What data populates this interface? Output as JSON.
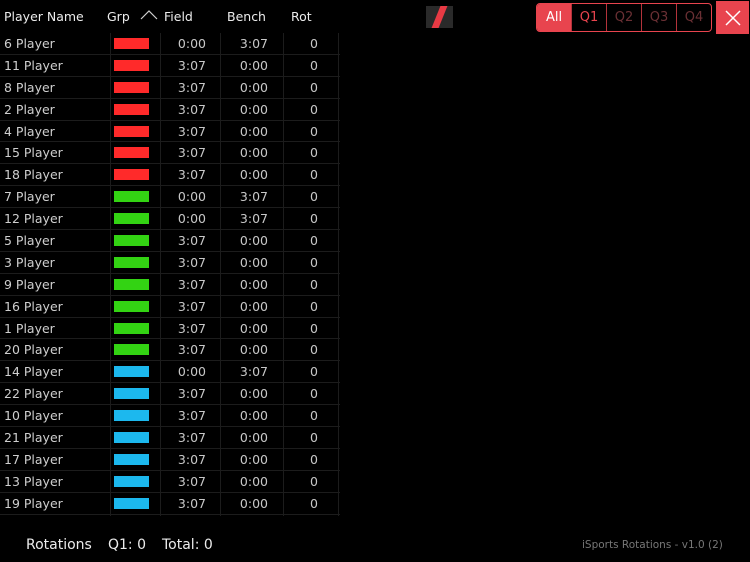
{
  "header": {
    "player_name": "Player Name",
    "grp": "Grp",
    "field": "Field",
    "bench": "Bench",
    "rot": "Rot",
    "sort_icon": "chevron-up-icon"
  },
  "filter": {
    "options": [
      "All",
      "Q1",
      "Q2",
      "Q3",
      "Q4"
    ],
    "selected": "All",
    "accent": "#e8444e"
  },
  "close_icon": "close-icon",
  "group_colors": {
    "red": "#ff2a2a",
    "green": "#33d313",
    "blue": "#1cb8ee"
  },
  "players": [
    {
      "name": "6 Player",
      "group": "red",
      "field": "0:00",
      "bench": "3:07",
      "rot": "0"
    },
    {
      "name": "11 Player",
      "group": "red",
      "field": "3:07",
      "bench": "0:00",
      "rot": "0"
    },
    {
      "name": "8 Player",
      "group": "red",
      "field": "3:07",
      "bench": "0:00",
      "rot": "0"
    },
    {
      "name": "2 Player",
      "group": "red",
      "field": "3:07",
      "bench": "0:00",
      "rot": "0"
    },
    {
      "name": "4 Player",
      "group": "red",
      "field": "3:07",
      "bench": "0:00",
      "rot": "0"
    },
    {
      "name": "15 Player",
      "group": "red",
      "field": "3:07",
      "bench": "0:00",
      "rot": "0"
    },
    {
      "name": "18 Player",
      "group": "red",
      "field": "3:07",
      "bench": "0:00",
      "rot": "0"
    },
    {
      "name": "7 Player",
      "group": "green",
      "field": "0:00",
      "bench": "3:07",
      "rot": "0"
    },
    {
      "name": "12 Player",
      "group": "green",
      "field": "0:00",
      "bench": "3:07",
      "rot": "0"
    },
    {
      "name": "5 Player",
      "group": "green",
      "field": "3:07",
      "bench": "0:00",
      "rot": "0"
    },
    {
      "name": "3 Player",
      "group": "green",
      "field": "3:07",
      "bench": "0:00",
      "rot": "0"
    },
    {
      "name": "9 Player",
      "group": "green",
      "field": "3:07",
      "bench": "0:00",
      "rot": "0"
    },
    {
      "name": "16 Player",
      "group": "green",
      "field": "3:07",
      "bench": "0:00",
      "rot": "0"
    },
    {
      "name": "1 Player",
      "group": "green",
      "field": "3:07",
      "bench": "0:00",
      "rot": "0"
    },
    {
      "name": "20 Player",
      "group": "green",
      "field": "3:07",
      "bench": "0:00",
      "rot": "0"
    },
    {
      "name": "14 Player",
      "group": "blue",
      "field": "0:00",
      "bench": "3:07",
      "rot": "0"
    },
    {
      "name": "22 Player",
      "group": "blue",
      "field": "3:07",
      "bench": "0:00",
      "rot": "0"
    },
    {
      "name": "10 Player",
      "group": "blue",
      "field": "3:07",
      "bench": "0:00",
      "rot": "0"
    },
    {
      "name": "21 Player",
      "group": "blue",
      "field": "3:07",
      "bench": "0:00",
      "rot": "0"
    },
    {
      "name": "17 Player",
      "group": "blue",
      "field": "3:07",
      "bench": "0:00",
      "rot": "0"
    },
    {
      "name": "13 Player",
      "group": "blue",
      "field": "3:07",
      "bench": "0:00",
      "rot": "0"
    },
    {
      "name": "19 Player",
      "group": "blue",
      "field": "3:07",
      "bench": "0:00",
      "rot": "0"
    }
  ],
  "footer": {
    "rotations": "Rotations",
    "q1": "Q1: 0",
    "total": "Total: 0",
    "version": "iSports Rotations - v1.0 (2)"
  }
}
